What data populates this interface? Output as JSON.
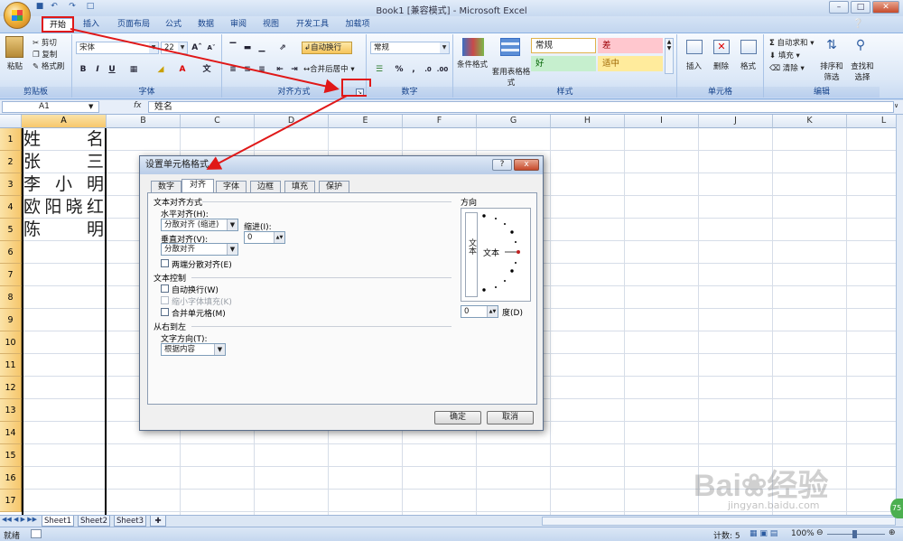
{
  "window": {
    "title": "Book1 [兼容模式] - Microsoft Excel"
  },
  "ribbon_tabs": [
    "开始",
    "插入",
    "页面布局",
    "公式",
    "数据",
    "审阅",
    "视图",
    "开发工具",
    "加载项"
  ],
  "clipboard": {
    "paste": "粘贴",
    "cut": "剪切",
    "copy": "复制",
    "format_painter": "格式刷",
    "label": "剪贴板"
  },
  "font": {
    "name": "宋体",
    "size": "22",
    "label": "字体"
  },
  "alignment": {
    "wrap": "自动换行",
    "merge": "合并后居中",
    "label": "对齐方式"
  },
  "number": {
    "format": "常规",
    "percent": "%",
    "label": "数字"
  },
  "styles": {
    "conditional": "条件格式",
    "table_style": "套用表格格式",
    "normal": "常规",
    "bad": "差",
    "good": "好",
    "neutral": "适中",
    "label": "样式"
  },
  "cells": {
    "insert": "插入",
    "delete": "删除",
    "format": "格式",
    "label": "单元格"
  },
  "editing": {
    "autosum": "自动求和",
    "fill": "填充",
    "clear": "清除",
    "sort": "排序和筛选",
    "find": "查找和选择",
    "label": "编辑"
  },
  "formula_bar": {
    "name_box": "A1",
    "fx": "fx",
    "content": "姓名"
  },
  "columns": [
    "A",
    "B",
    "C",
    "D",
    "E",
    "F",
    "G",
    "H",
    "I",
    "J",
    "K",
    "L"
  ],
  "rows": [
    "1",
    "2",
    "3",
    "4",
    "5",
    "6",
    "7",
    "8",
    "9",
    "10",
    "11",
    "12",
    "13",
    "14",
    "15",
    "16",
    "17"
  ],
  "cells_data": [
    "姓名",
    "张三",
    "李小明",
    "欧阳晓红",
    "陈明"
  ],
  "dialog": {
    "title": "设置单元格格式",
    "help": "?",
    "close": "x",
    "tabs": [
      "数字",
      "对齐",
      "字体",
      "边框",
      "填充",
      "保护"
    ],
    "text_align_section": "文本对齐方式",
    "horizontal_label": "水平对齐(H):",
    "horizontal_value": "分散对齐 (缩进)",
    "indent_label": "缩进(I):",
    "indent_value": "0",
    "vertical_label": "垂直对齐(V):",
    "vertical_value": "分散对齐",
    "justify_distributed": "两端分散对齐(E)",
    "text_control_section": "文本控制",
    "wrap_text": "自动换行(W)",
    "shrink_to_fit": "缩小字体填充(K)",
    "merge_cells": "合并单元格(M)",
    "rtl_section": "从右到左",
    "text_direction_label": "文字方向(T):",
    "text_direction_value": "根据内容",
    "orientation_section": "方向",
    "vertical_text": "文本",
    "horizontal_text": "文本",
    "degrees_value": "0",
    "degrees_label": "度(D)",
    "ok": "确定",
    "cancel": "取消"
  },
  "sheets": [
    "Sheet1",
    "Sheet2",
    "Sheet3"
  ],
  "status": {
    "mode": "就绪",
    "count": "计数: 5",
    "zoom": "100%"
  },
  "watermark": {
    "brand": "Bai",
    "brand2": "经验",
    "url": "jingyan.baidu.com"
  },
  "colors": {
    "arrow": "#e01818",
    "header_selected": "#f6c76c",
    "ribbon_blue": "#15428b"
  }
}
